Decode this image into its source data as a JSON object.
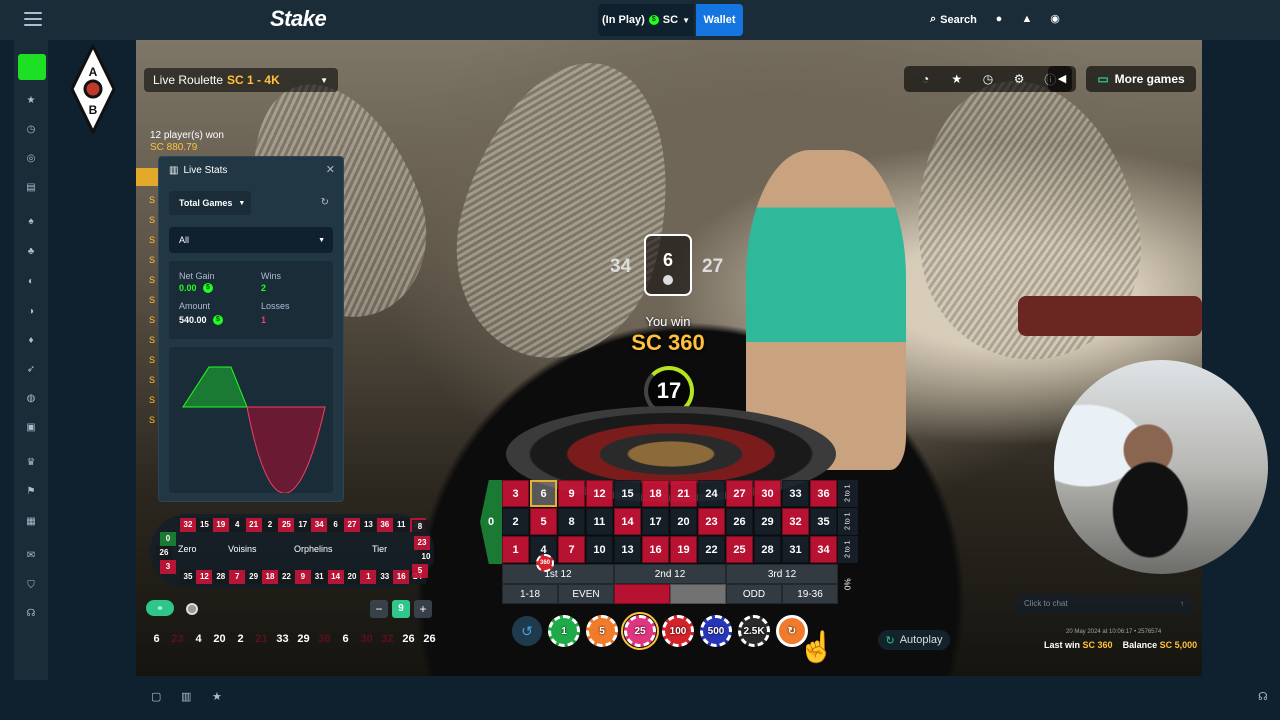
{
  "header": {
    "logo": "Stake",
    "in_play_label": "(In Play)",
    "currency": "SC",
    "wallet_label": "Wallet",
    "search_label": "Search"
  },
  "badge_letters": [
    "A",
    "B"
  ],
  "game": {
    "title_prefix": "Live Roulette",
    "title_suffix": "SC 1 - 4K",
    "more_games_label": "More games",
    "players_won": "12 player(s) won",
    "players_won_amount": "SC 880.79",
    "card_value": "6",
    "left_number": "34",
    "right_number": "27",
    "you_win_label": "You win",
    "win_amount": "SC 360",
    "timer": "17",
    "chat_placeholder": "Click to chat",
    "timestamp": "20 May 2024 at 10:06:17 • 2576574",
    "last_win_label": "Last win",
    "last_win_value": "SC 360",
    "balance_label": "Balance",
    "balance_value": "SC 5,000",
    "autoplay_label": "Autoplay"
  },
  "live_stats": {
    "title": "Live Stats",
    "filter1": "Total Games",
    "filter2": "All",
    "net_gain_label": "Net Gain",
    "net_gain_value": "0.00",
    "wins_label": "Wins",
    "wins_value": "2",
    "amount_label": "Amount",
    "amount_value": "540.00",
    "losses_label": "Losses",
    "losses_value": "1"
  },
  "board": {
    "zero": "0",
    "rows": [
      [
        [
          "3",
          "r"
        ],
        [
          "6",
          "h"
        ],
        [
          "9",
          "r"
        ],
        [
          "12",
          "r"
        ],
        [
          "15",
          "b"
        ],
        [
          "18",
          "r"
        ],
        [
          "21",
          "r"
        ],
        [
          "24",
          "b"
        ],
        [
          "27",
          "r"
        ],
        [
          "30",
          "r"
        ],
        [
          "33",
          "b"
        ],
        [
          "36",
          "r"
        ]
      ],
      [
        [
          "2",
          "b"
        ],
        [
          "5",
          "r"
        ],
        [
          "8",
          "b"
        ],
        [
          "11",
          "b"
        ],
        [
          "14",
          "r"
        ],
        [
          "17",
          "b"
        ],
        [
          "20",
          "b"
        ],
        [
          "23",
          "r"
        ],
        [
          "26",
          "b"
        ],
        [
          "29",
          "b"
        ],
        [
          "32",
          "r"
        ],
        [
          "35",
          "b"
        ]
      ],
      [
        [
          "1",
          "r"
        ],
        [
          "4",
          "b"
        ],
        [
          "7",
          "r"
        ],
        [
          "10",
          "b"
        ],
        [
          "13",
          "b"
        ],
        [
          "16",
          "r"
        ],
        [
          "19",
          "r"
        ],
        [
          "22",
          "b"
        ],
        [
          "25",
          "r"
        ],
        [
          "28",
          "b"
        ],
        [
          "31",
          "b"
        ],
        [
          "34",
          "r"
        ]
      ]
    ],
    "column_label": "2 to 1",
    "dozens": [
      "1st 12",
      "2nd 12",
      "3rd 12"
    ],
    "outside": [
      "1-18",
      "EVEN",
      "",
      "",
      "ODD",
      "19-36"
    ],
    "percent_label": "0%",
    "chip_on_board": "360"
  },
  "racetrack": {
    "sections": [
      "Zero",
      "Voisins",
      "Orphelins",
      "Tier"
    ],
    "numbers_top": [
      "32",
      "15",
      "19",
      "4",
      "21",
      "2",
      "25",
      "17",
      "34",
      "6",
      "27",
      "13",
      "36",
      "11",
      "30"
    ],
    "numbers_bottom": [
      "35",
      "12",
      "28",
      "7",
      "29",
      "18",
      "22",
      "9",
      "31",
      "14",
      "20",
      "1",
      "33",
      "16",
      "24"
    ],
    "side_left": [
      "0",
      "26",
      "3"
    ],
    "side_right": [
      "8",
      "23",
      "10",
      "5"
    ],
    "stepper_value": "9"
  },
  "history": [
    "6",
    "23",
    "4",
    "20",
    "2",
    "21",
    "33",
    "29",
    "30",
    "6",
    "30",
    "32",
    "26",
    "26"
  ],
  "chips": [
    "1",
    "5",
    "25",
    "100",
    "500",
    "2.5K",
    ""
  ]
}
